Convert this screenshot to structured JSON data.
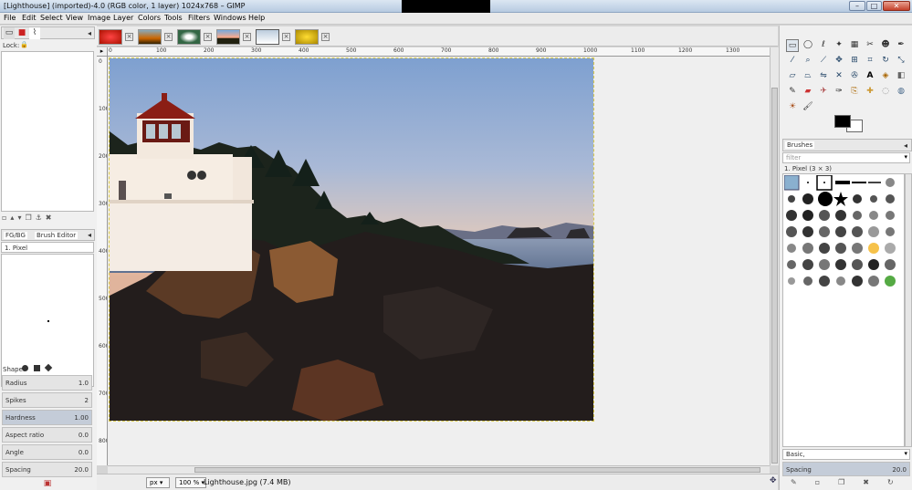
{
  "window": {
    "title": "[Lighthouse] (imported)-4.0 (RGB color, 1 layer) 1024x768 – GIMP",
    "min_label": "–",
    "max_label": "□",
    "close_label": "✕"
  },
  "menu": [
    "File",
    "Edit",
    "Select",
    "View",
    "Image",
    "Layer",
    "Colors",
    "Tools",
    "Filters",
    "Windows",
    "Help"
  ],
  "left_dock": {
    "lock_label": "Lock:",
    "tab_fgbg": "FG/BG",
    "tab_brush_editor": "Brush Editor",
    "brush_name": "1. Pixel",
    "shape_label": "Shape:",
    "sliders": [
      {
        "label": "Radius",
        "value": "1.0"
      },
      {
        "label": "Spikes",
        "value": "2"
      },
      {
        "label": "Hardness",
        "value": "1.00"
      },
      {
        "label": "Aspect ratio",
        "value": "0.0"
      },
      {
        "label": "Angle",
        "value": "0.0"
      },
      {
        "label": "Spacing",
        "value": "20.0"
      }
    ]
  },
  "ruler": {
    "h_ticks": [
      "0",
      "100",
      "200",
      "300",
      "400",
      "500",
      "600",
      "700",
      "800",
      "900",
      "1000",
      "1100",
      "1200",
      "1300"
    ],
    "v_ticks": [
      "0",
      "100",
      "200",
      "300",
      "400",
      "500",
      "600",
      "700",
      "800"
    ]
  },
  "status": {
    "unit": "px",
    "zoom": "100 %",
    "file": "Lighthouse.jpg (7.4 MB)"
  },
  "right_dock": {
    "brushes_tab": "Brushes",
    "filter_placeholder": "filter",
    "brush_info": "1. Pixel (3 × 3)",
    "preset": "Basic,",
    "spacing_label": "Spacing",
    "spacing_value": "20.0"
  },
  "colors": {
    "fg": "#000000",
    "bg": "#ffffff",
    "accent": "#c4ccd8"
  }
}
